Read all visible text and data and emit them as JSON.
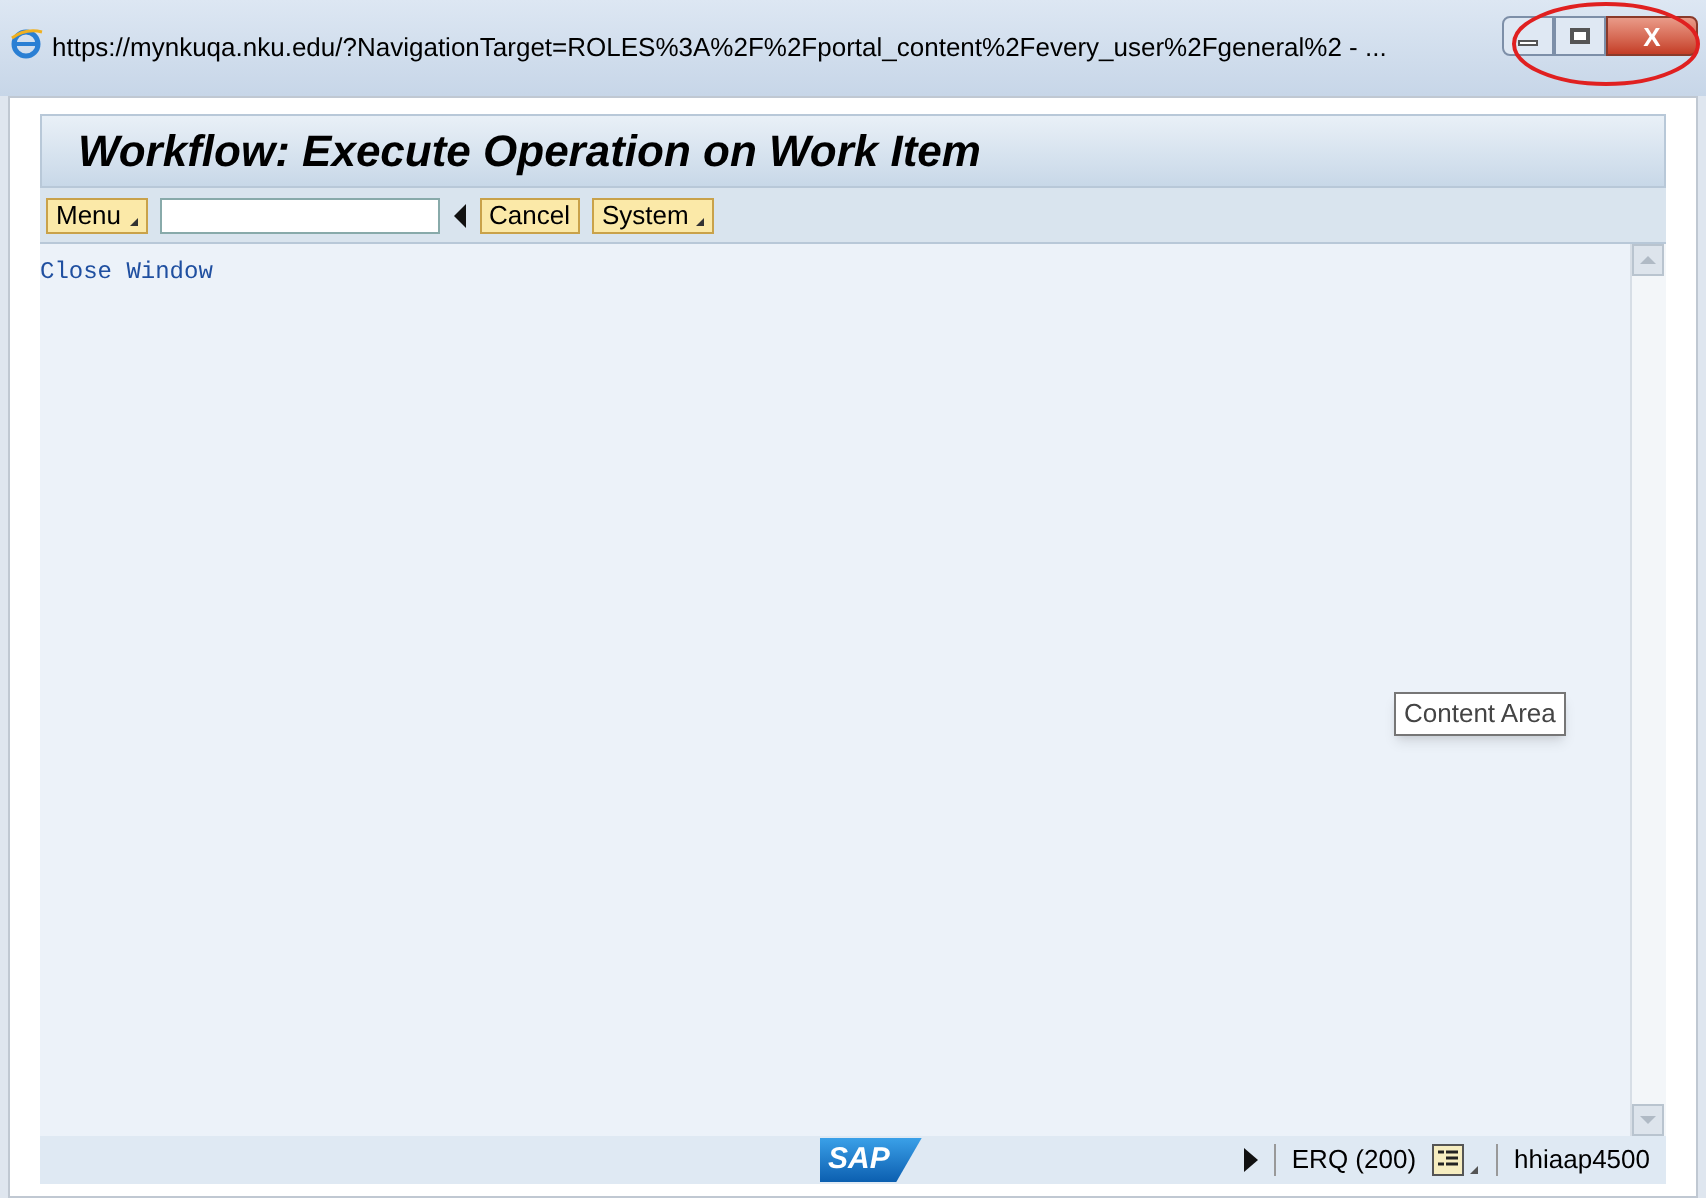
{
  "window": {
    "url": "https://mynkuqa.nku.edu/?NavigationTarget=ROLES%3A%2F%2Fportal_content%2Fevery_user%2Fgeneral%2 - ...",
    "close_label": "X"
  },
  "header": {
    "title": "Workflow: Execute Operation on Work Item"
  },
  "toolbar": {
    "menu": "Menu",
    "cancel": "Cancel",
    "system": "System"
  },
  "content": {
    "link": "Close Window",
    "tooltip": "Content Area"
  },
  "status_bar": {
    "logo": "SAP",
    "system": "ERQ (200)",
    "server": "hhiaap4500"
  }
}
